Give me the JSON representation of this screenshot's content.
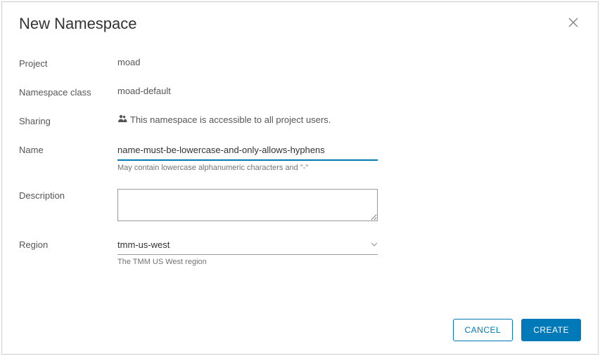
{
  "modal": {
    "title": "New Namespace",
    "close_label": "×"
  },
  "form": {
    "project": {
      "label": "Project",
      "value": "moad"
    },
    "namespace_class": {
      "label": "Namespace class",
      "value": "moad-default"
    },
    "sharing": {
      "label": "Sharing",
      "value": "This namespace is accessible to all project users."
    },
    "name": {
      "label": "Name",
      "value": "name-must-be-lowercase-and-only-allows-hyphens",
      "helper": "May contain lowercase alphanumeric characters and \"-\""
    },
    "description": {
      "label": "Description",
      "value": ""
    },
    "region": {
      "label": "Region",
      "value": "tmm-us-west",
      "helper": "The TMM US West region"
    }
  },
  "footer": {
    "cancel_label": "CANCEL",
    "create_label": "CREATE"
  }
}
